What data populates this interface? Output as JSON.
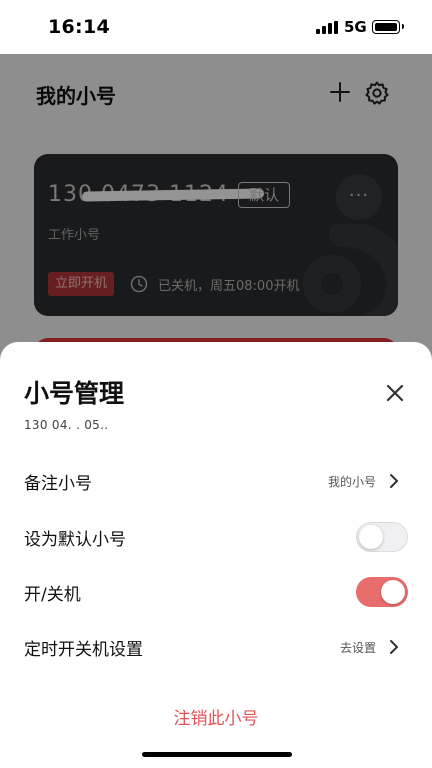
{
  "status_bar": {
    "time": "16:14",
    "network": "5G"
  },
  "background": {
    "title": "我的小号",
    "add_icon": "plus-icon",
    "settings_icon": "gear-icon",
    "card": {
      "number": "130 0473 1124",
      "default_badge": "默认",
      "more_label": "···",
      "remark": "工作小号",
      "power_on_button": "立即开机",
      "status_text": "已关机，周五08:00开机"
    }
  },
  "sheet": {
    "title": "小号管理",
    "subtitle": "130 04. . 05..",
    "rows": [
      {
        "label": "备注小号",
        "value": "我的小号"
      },
      {
        "label": "设为默认小号",
        "toggle_on": false
      },
      {
        "label": "开/关机",
        "toggle_on": true
      },
      {
        "label": "定时开关机设置",
        "value": "去设置"
      }
    ],
    "deregister_label": "注销此小号"
  },
  "colors": {
    "accent": "#e0555a",
    "toggle_on": "#ea6d6d",
    "card_bg": "#2b2d31"
  }
}
